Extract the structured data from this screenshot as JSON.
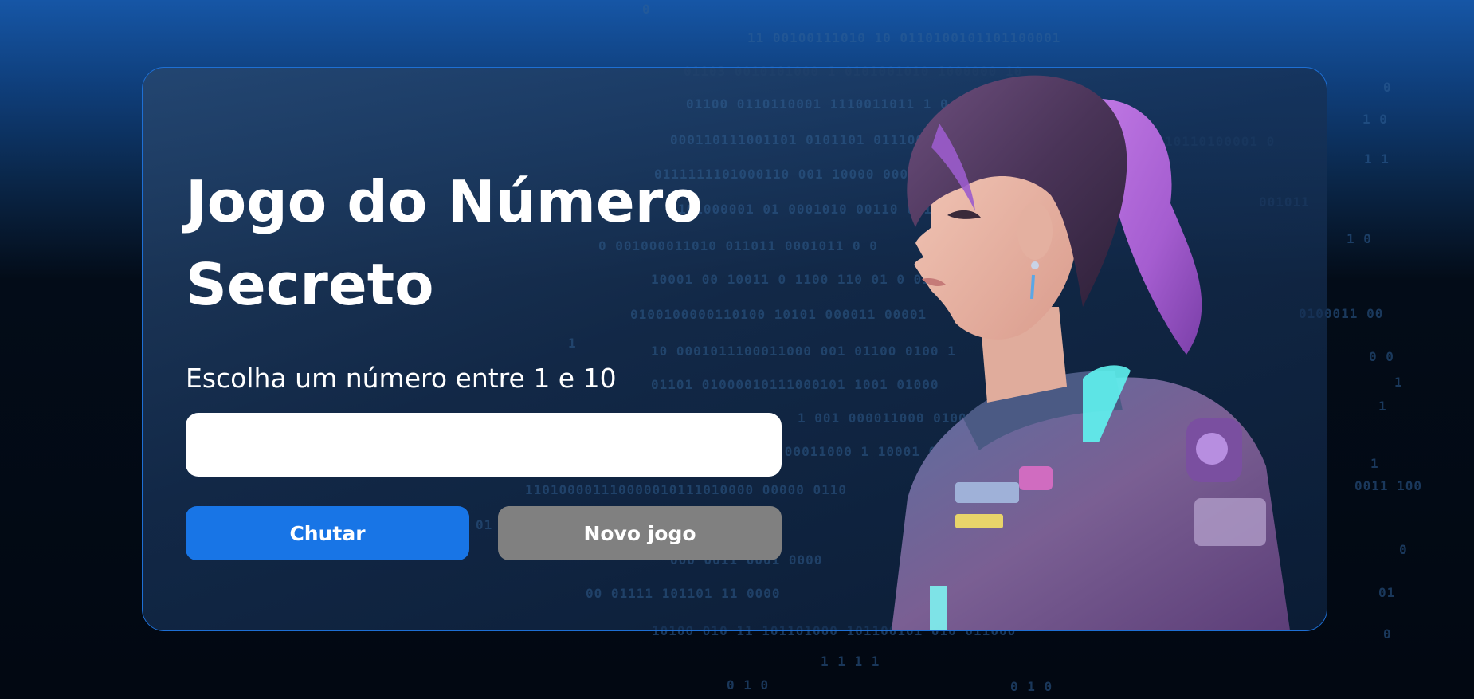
{
  "game": {
    "title": "Jogo do Número Secreto",
    "prompt": "Escolha um número entre 1 e 10",
    "input_value": "",
    "guess_button": "Chutar",
    "new_game_button": "Novo jogo"
  },
  "colors": {
    "accent": "#1875e6",
    "disabled": "#808080",
    "card_border": "#1e6fd4",
    "background_top": "#1656a6",
    "background_bottom": "#020812"
  },
  "illustration": {
    "subject": "astronaut-girl-illustration",
    "hair_color": "#b56fd8",
    "suit_glow": "#5ff3f0"
  }
}
